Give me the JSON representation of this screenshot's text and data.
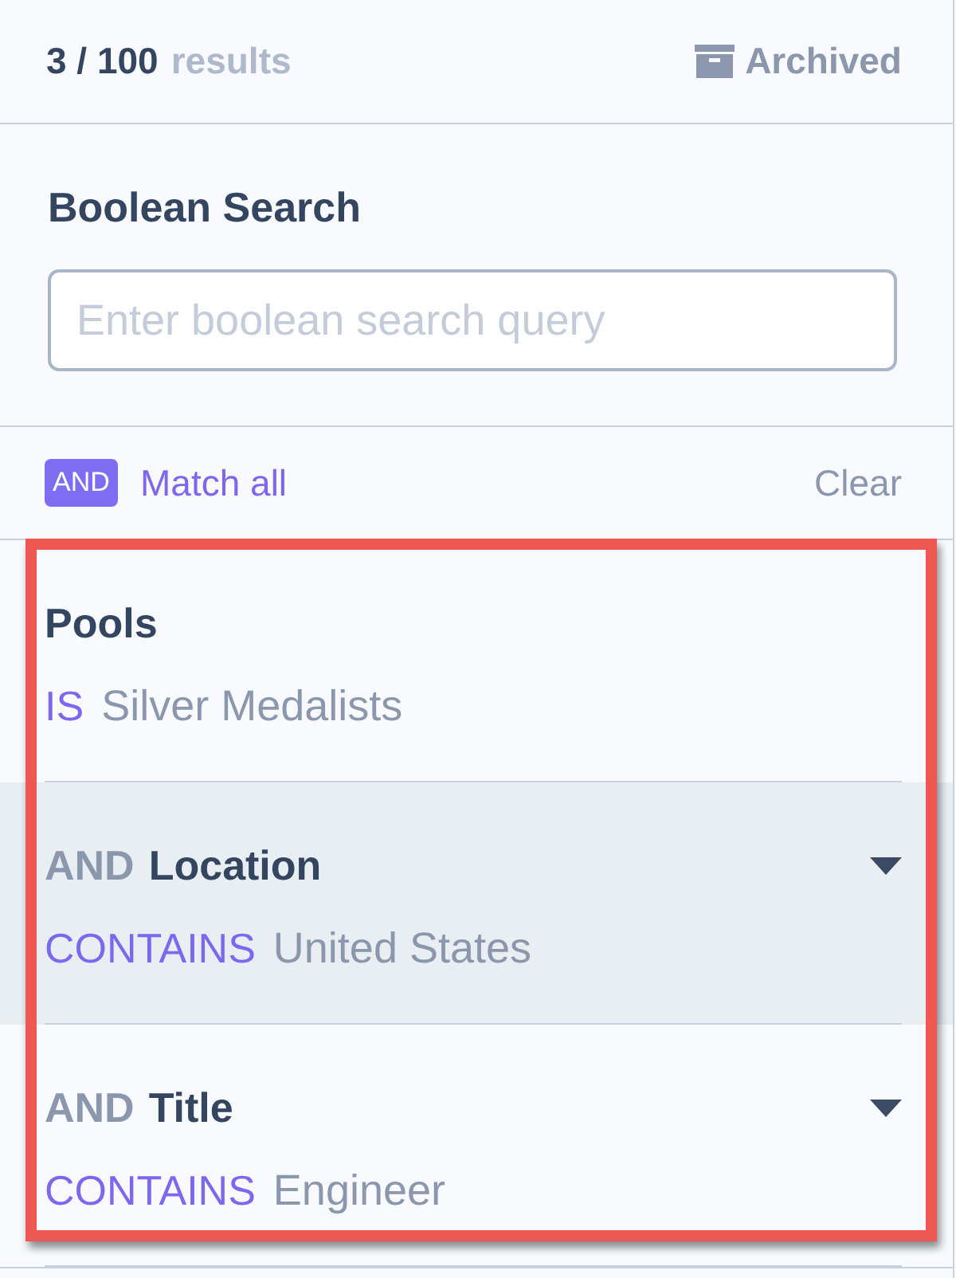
{
  "header": {
    "count": "3 / 100",
    "count_label": "results",
    "archived": {
      "label": "Archived"
    }
  },
  "boolean_search": {
    "title": "Boolean Search",
    "placeholder": "Enter boolean search query"
  },
  "match_bar": {
    "badge": "AND",
    "mode": "Match all",
    "clear": "Clear"
  },
  "filter_group": {
    "highlighted": true,
    "items": [
      {
        "field": "Pools",
        "operator": "IS",
        "value": "Silver Medalists",
        "dropdown": false,
        "selected": false
      },
      {
        "connector": "AND",
        "field": "Location",
        "operator": "CONTAINS",
        "value": "United States",
        "dropdown": true,
        "selected": true
      },
      {
        "connector": "AND",
        "field": "Title",
        "operator": "CONTAINS",
        "value": "Engineer",
        "dropdown": true,
        "selected": false
      }
    ]
  }
}
